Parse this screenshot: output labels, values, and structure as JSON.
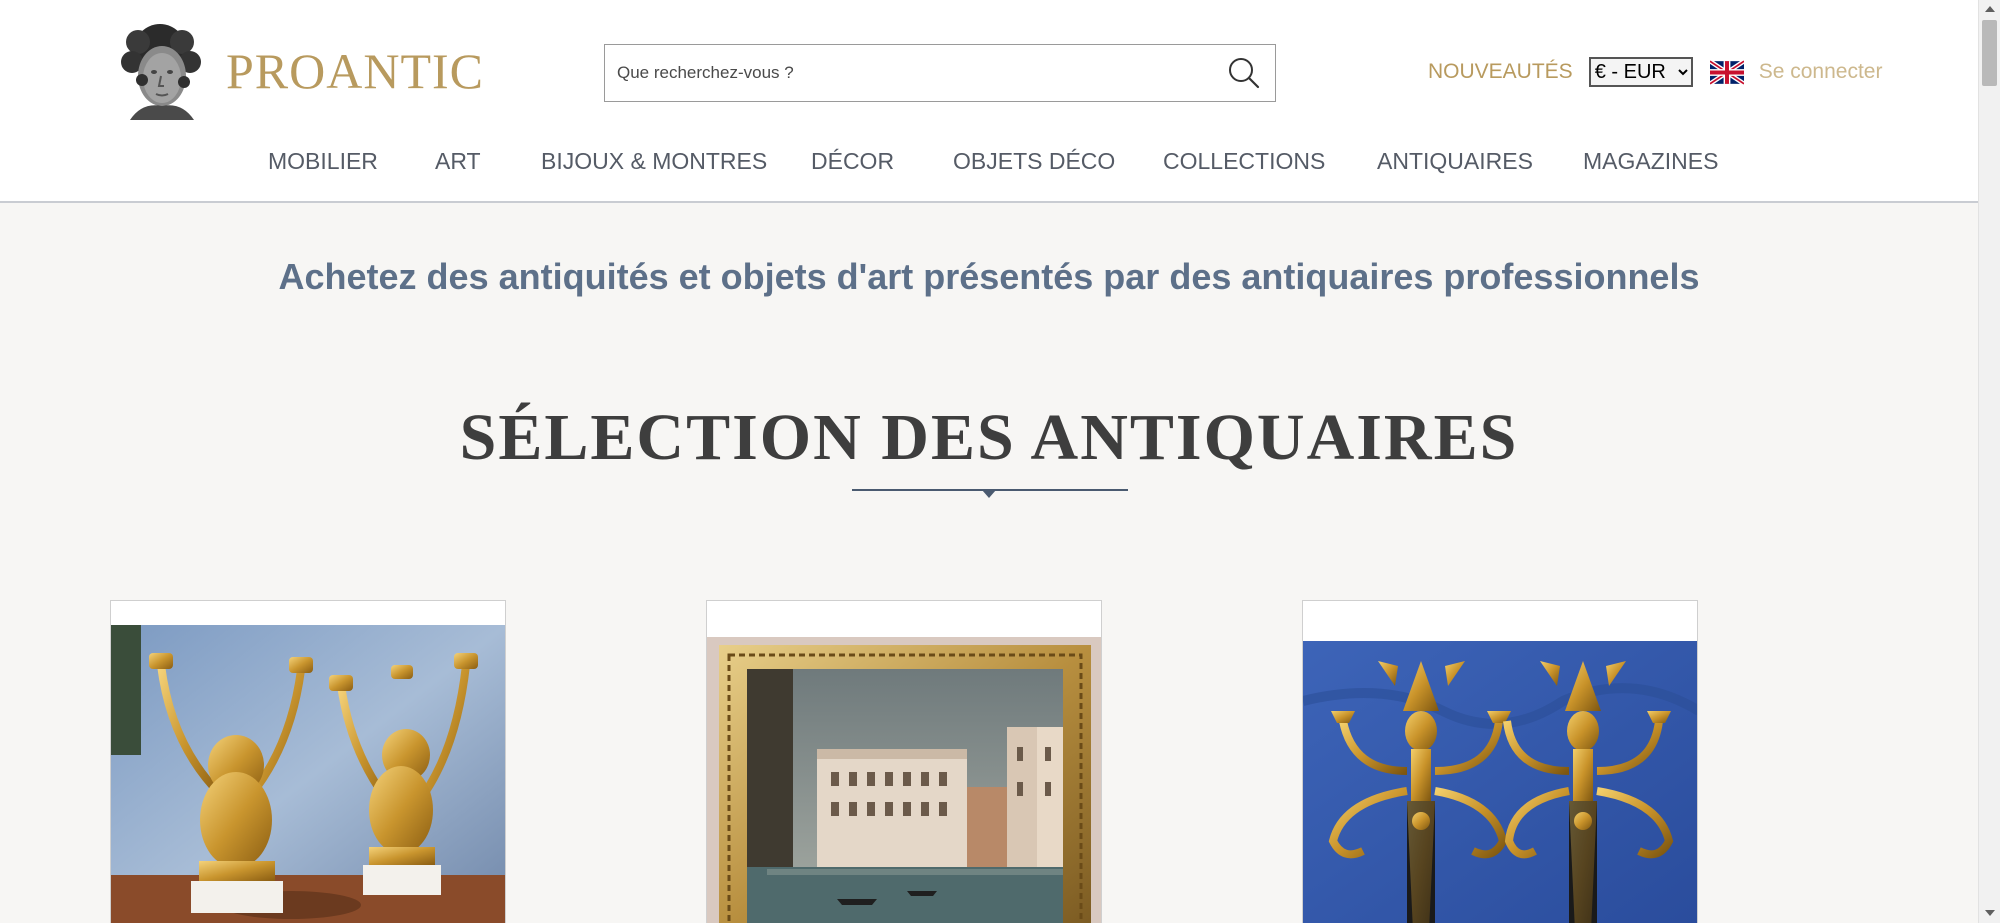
{
  "header": {
    "logo_text": "PROANTIC",
    "search": {
      "placeholder": "Que recherchez-vous ?"
    },
    "nouveautes_label": "NOUVEAUTÉS",
    "currency": {
      "selected": "€ - EUR",
      "options": [
        "€ - EUR"
      ]
    },
    "login_label": "Se connecter",
    "icons": {
      "search": "search-icon",
      "flag": "uk-flag-icon"
    }
  },
  "nav": {
    "items": [
      {
        "label": "MOBILIER"
      },
      {
        "label": "ART"
      },
      {
        "label": "BIJOUX & MONTRES"
      },
      {
        "label": "DÉCOR"
      },
      {
        "label": "OBJETS DÉCO"
      },
      {
        "label": "COLLECTIONS"
      },
      {
        "label": "ANTIQUAIRES"
      },
      {
        "label": "MAGAZINES"
      }
    ]
  },
  "main": {
    "tagline": "Achetez des antiquités et objets d'art présentés par des antiquaires professionnels",
    "section_title": "SÉLECTION DES ANTIQUAIRES"
  },
  "colors": {
    "accent_gold": "#b89a5e",
    "tagline_blue": "#5d7089",
    "nav_text": "#555b66",
    "page_bg": "#f7f6f4"
  }
}
